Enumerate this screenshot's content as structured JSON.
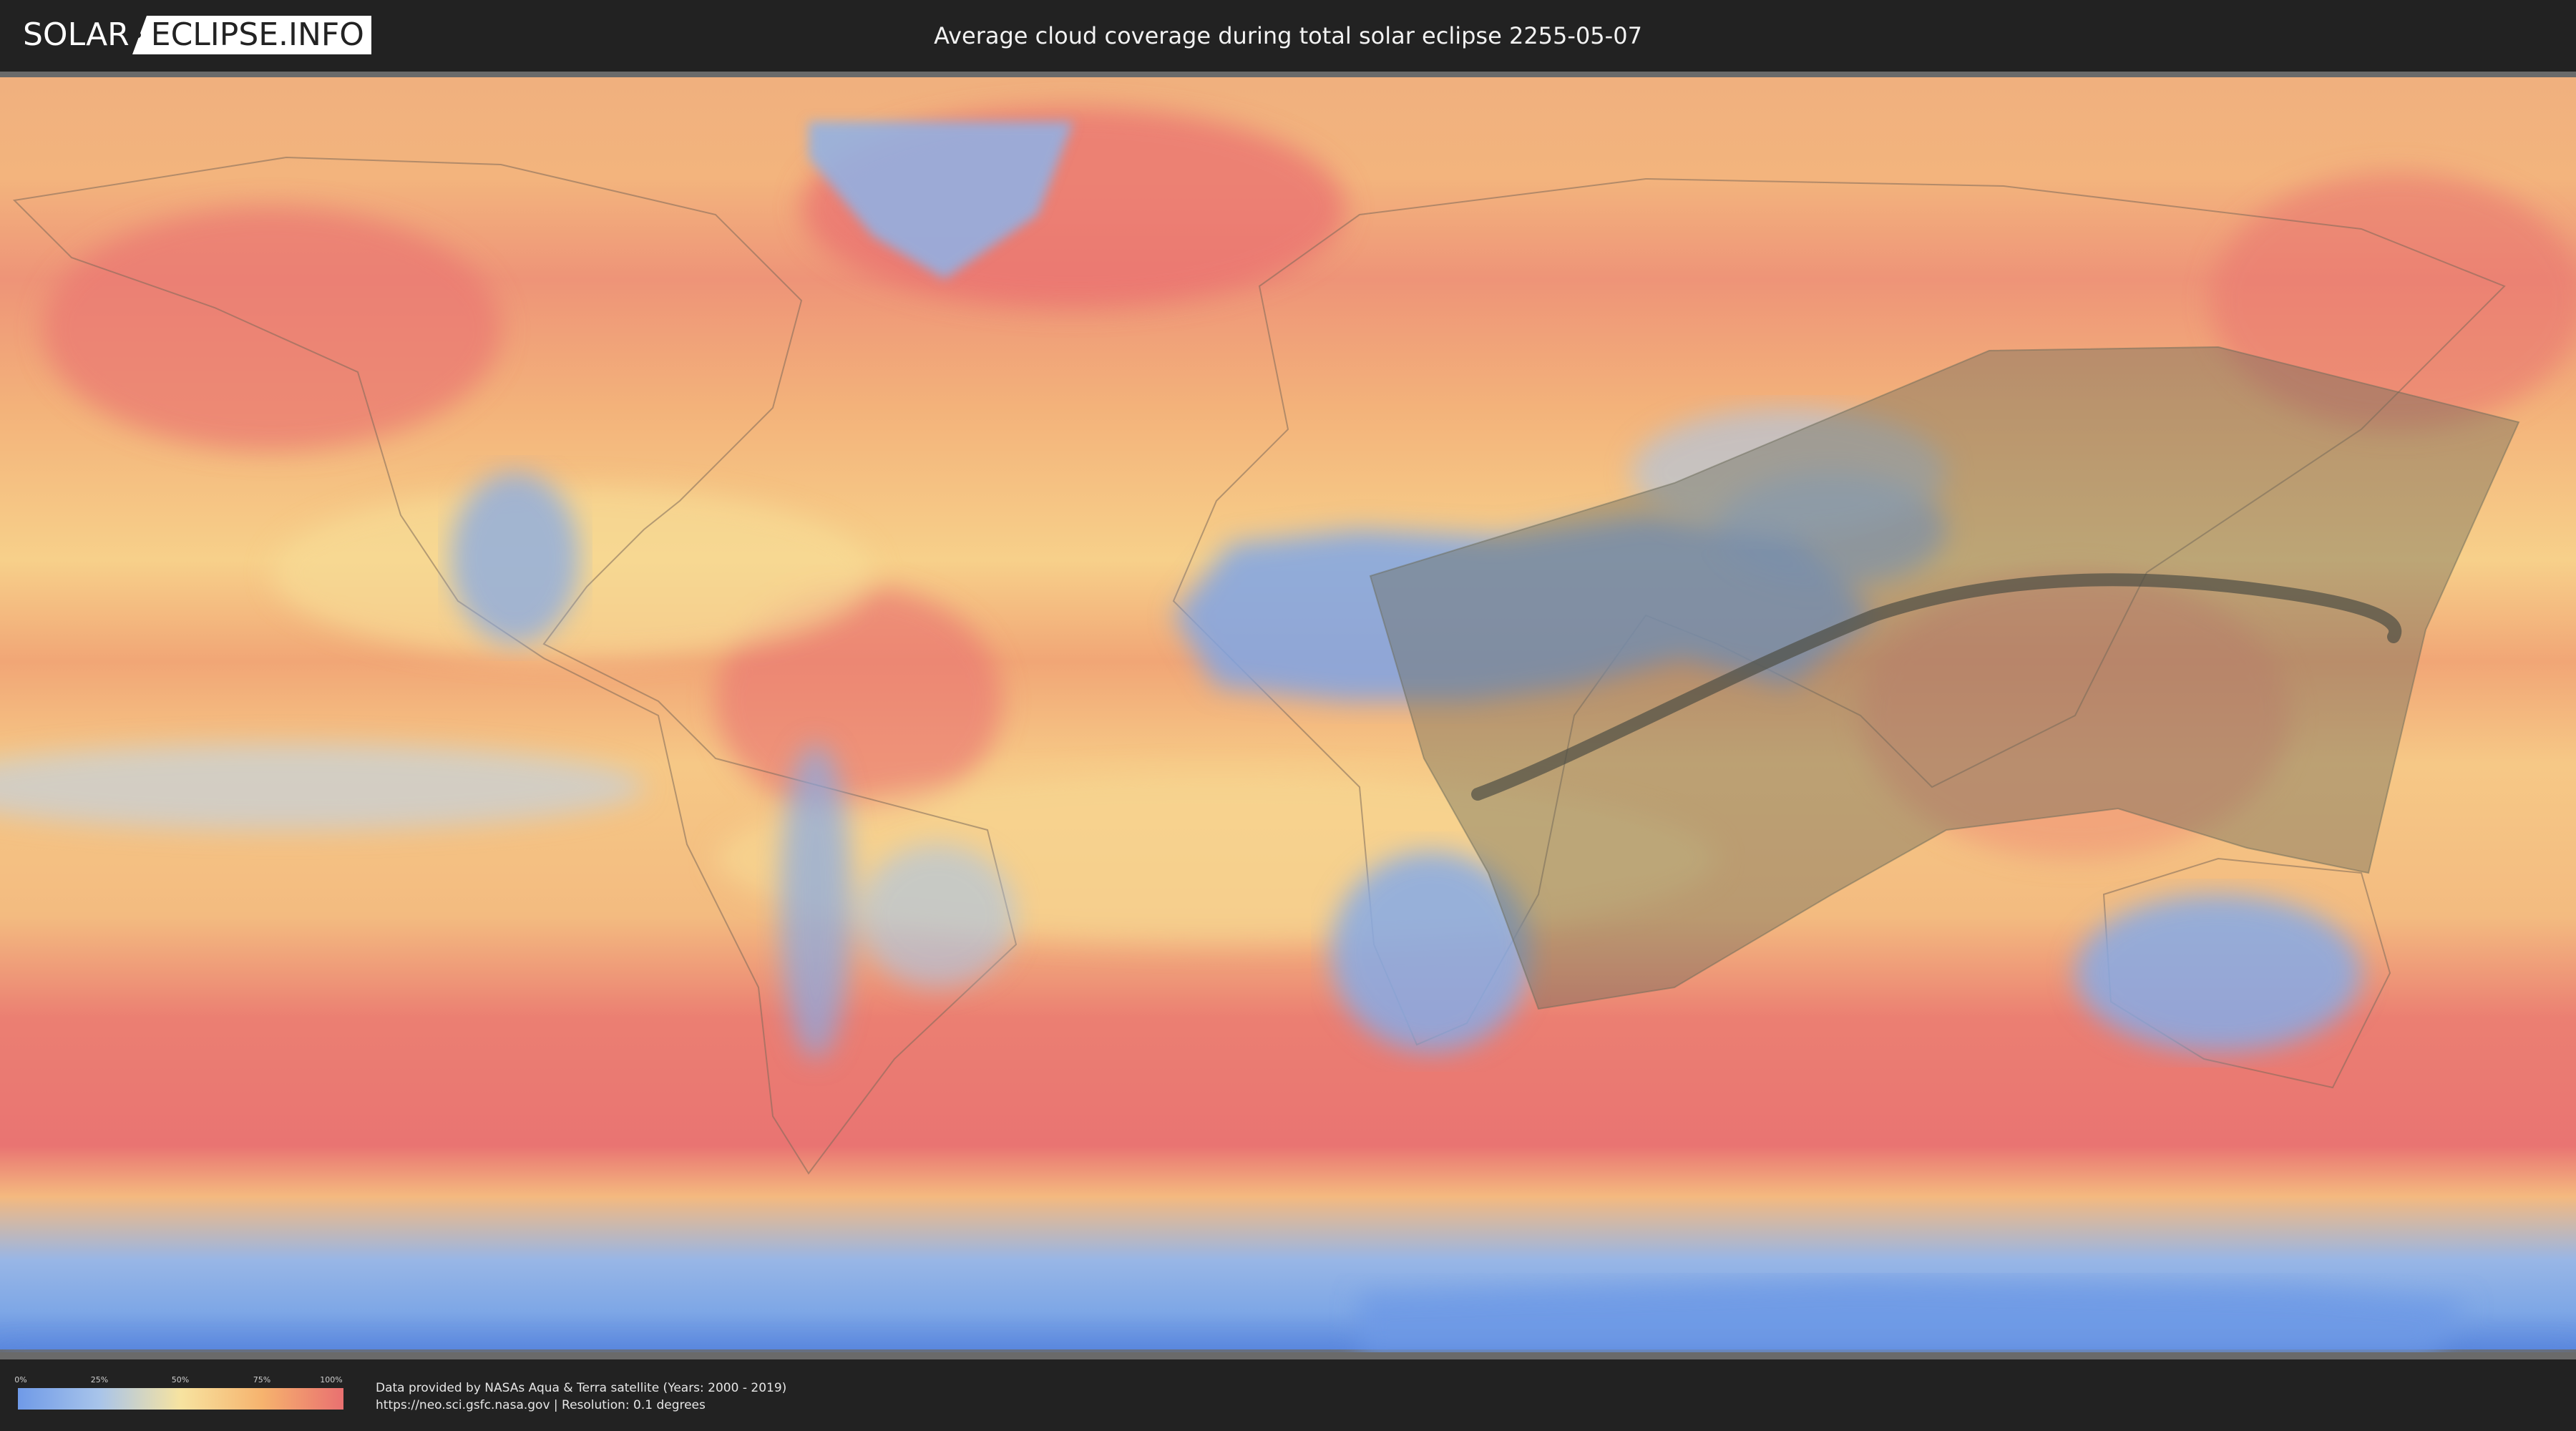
{
  "header": {
    "logo_left": "SOLAR",
    "logo_right": "ECLIPSE.INFO",
    "title": "Average cloud coverage during total solar eclipse 2255-05-07"
  },
  "legend": {
    "ticks": [
      "0%",
      "25%",
      "50%",
      "75%",
      "100%"
    ],
    "colors": [
      "#6f9ae8",
      "#a8c4ea",
      "#f7e3a0",
      "#f6b36e",
      "#e97070"
    ]
  },
  "credits": {
    "line1": "Data provided by NASAs Aqua & Terra satellite (Years: 2000 - 2019)",
    "line2": "https://neo.sci.gsfc.nasa.gov | Resolution: 0.1 degrees"
  },
  "map": {
    "colors": {
      "cloudy": "#ea7470",
      "mid": "#f5c783",
      "clear": "#7ea7e6",
      "path_shade": "#6b6b5a",
      "centerline": "#4f4f44"
    }
  }
}
